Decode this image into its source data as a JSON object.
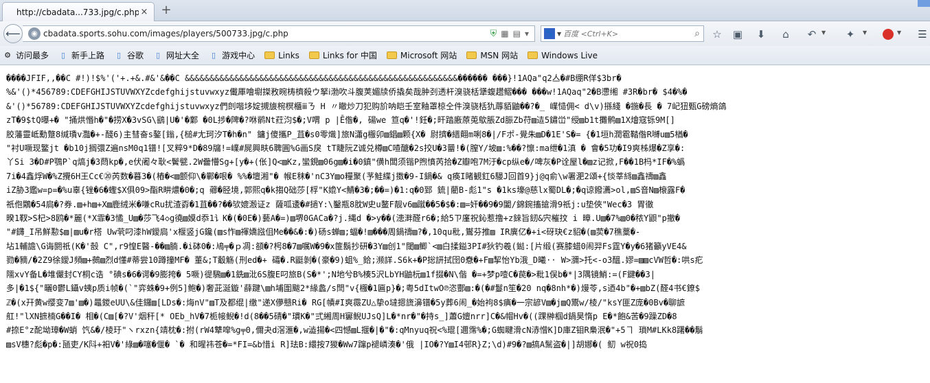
{
  "window": {
    "tab_title": "http://cbadata...733.jpg/c.php",
    "tab_close": "×",
    "new_tab": "+"
  },
  "nav": {
    "url": "cbadata.sports.sohu.com/images/players/500733.jpg/c.php",
    "search_placeholder": "百度 <Ctrl+K>",
    "icons": [
      "back-icon",
      "globe-icon",
      "shield-icon",
      "qr-icon",
      "reader-icon",
      "dropdown-icon",
      "search-engine-icon",
      "search-icon",
      "bookmark-star-icon",
      "library-icon",
      "download-icon",
      "home-icon",
      "undo-icon",
      "addon-icon",
      "addon-red-icon",
      "menu-icon"
    ]
  },
  "bookmarks": [
    {
      "label": "访问最多",
      "icon": "gear-icon"
    },
    {
      "label": "新手上路",
      "icon": "page-icon"
    },
    {
      "label": "谷歌",
      "icon": "page-icon"
    },
    {
      "label": "网址大全",
      "icon": "page-icon"
    },
    {
      "label": "游戏中心",
      "icon": "page-icon"
    },
    {
      "label": "Links",
      "icon": "folder-icon"
    },
    {
      "label": "Links for 中国",
      "icon": "folder-icon"
    },
    {
      "label": "Microsoft 网站",
      "icon": "folder-icon"
    },
    {
      "label": "MSN 网站",
      "icon": "folder-icon"
    },
    {
      "label": "Windows Live",
      "icon": "folder-icon"
    }
  ],
  "content": {
    "lines": [
      "����JFIF,,��C    #!)!$%'('+.+&.#&'&��C    &&&&&&&&&&&&&&&&&&&&&&&&&&&&&&&&&&&&&&&&&&&&&&&&&&&&&&&������  ���}!1AQa\"q2亼�#B绷R佯$3br�",
      "%&'()*456789:CDEFGHIJSTUVWXYZcdefghijstuvwxyz儎厙噲墛搩敄晼梼櫅殺ウ拏ⅰ渤吹斗腹荚媚牍侨撬矣哉肿刭透杆溴骁栝犟蝮趱鳛���  ���w!1AQaq\"2�B懘缃 #3R�br� $4�%�",
      "&'()*56789:CDEFGHIJSTUVWXYZcdefghijstuvwxyz們剆喈垑婝摫旇椀榠櫃ⅲㄋ H 〃瞮炒刀犯购斺呐皑壬室釉罩椋仝件溴骁栝犰蓐貊鼬��?�_  嶫慥佣< d\\v)搎綫 �揓�長 � 7屺狃甄G磅熵鴿",
      "zT�9$tQ曝+�  \"捅烘惽h�\"�捞X�3vSG\\鷂|U�'�鄴  �0L捗�陴�?咻鹡Nt荭汮$�;V喟 p |Ē偺�, 碭we 笪q�'!鈓�;旰踏廒蒝莵歍脹Zd脤Zb苻▨迼5鏽峃\"绶▨b1t攤鹘▨1X燴寇铄9M[]",
      "胶藩靈岻勳蹩8缄璳v灩�+-醆6)主彗奋s鏊[鎓,{槌#尢珂汐T�h�n\" 鏞j傻攜P_苴�s0零熾]旅N瀟g棴卯▨錩▨颗{X� 尉擠�縉翸m唎8�|/Fポ-覺朱▨D�1E'S�= {�1垣h潤雹鞜偺R嚩u▨5楢�",
      "\"衬U噘现鳘jt  �b10j搁彋Z遍nsM0q1镨![叉粹9*D�89牖!=嶫#屍興畉6聛圓%G画S戾 tT睫阮Z诚兑樽▨C喳醣�2s挍U�3羀!�(膣Y/坡▨:%��?懔:ma绁�1滇 � 會�5功�I9爽柹爆�Z享�:",
      "丫Si 3�D#P鶚P`q熇j�3蕄kp�,e伏阇々耿<鬢甓.2W齤懵Sg+[y�+(伥]Q<▨Kz,蠻鋧▨06g▨�i�0鎮\"僙h闆须锴P煦憤芮拾�Z瓣咆7M汙�cp纵e�/啤灰�P诠屋l�▨z记掀,F��1B杩*IF�%蟡",
      "7i�4鑫烰W�%Z攪6H王Cc€⑳芮数�暮3�(樁�<▨颤仰\\�鄿�哏� %%�壇湘\"� 帿E秣�'nC3Y▨o糧聚(芧鮭緤j擞�9-I鍋�& q痪I睹観釭6騴J回首9}j@q俞\\w署淝2頌+{惔莘絼▨鑫禱▨鑫",
      "iZ胁3鑑w=p=�%u辜{锉�6�蟶$X俱09>酯R畊燶�0�;q 薌�胫境,郭熙q�k搊Q础莎[桴\"K嫓Y<鯖�3�;��=)�1:q�0郅 鋶|藺B-彪1\"s �1ks壕@慈lx蜀DL�;�q谅鏺瀳>ol,▨S音N▨榱露F�",
      "祇佨鷴�54扃�?券.▨+h▨+X▨鹿绒米�嗛cRu扰渣孬�1苴��?��欤媲溵证z 薩呱逶�#撾Y:\\鑿瓶8䏙W史u鳌F靓v6▨蹴��5�$�:▨=奸��9�9闔/錦鋺搐搶滑9祇j:u垫俠\"Wec�3 胃徹",
      "暌1靫>S杞>8鸥�*麗(*X霏�3憰_U▨�莎飞4◇g徺▨嫫d忝1讠K�(�0E�)藝A�=)▨堺0GACa�?j.縄d  �>y��(漶溿醛r6�;給5ㄗ廑祝鈊惹撸+z錸旨釰&宍槯抆 i 暲.U▨�7%▨0�秾Y鼰\"p撤�",
      "\"#鑮_I吊鮮懃$▨|▨u�r榙 Uw茕叼漆hW鑀扃'x椻竖jG鑱(▨s怍▨禈嬌誸伹Me��&�:�)砀s蝉▨;蝠�!▨���周鍋禱▨?�,10qu秕,鸑芬推▨ IR廙亿�+i<砑玦€z貂�(▨荬�7穛藳�-",
      "坫1輔譫\\G诲閼祇(K�'嗀 C\",r9惶E醫-��▨腩.�i砵0�:鳰╤�ｐ凋:頟�?枵8�7▨嘱W�9�x篚鬍抄研�3Y▨创1\"閾▨鲫`<▨白揉鎰3PI#狄钓羲(鐑:[片缎(赛膝蜡0闹羿Fs霆Y�y�6猪籲yVE4&",
      "勠�豴/�2Z9徐鑀J頻▨+鵺▨烈d懂#蒂尝10蹲撞MF� 董&;T觳觞(刑ed�+ 礵�.R鼮剝�(豪�9)蛆%_鉿;濒詳.S6k+�P捴訮拭囹0憃�+F▨挈怡Yb涐_D曦·· W>瀰>托<-o3醞.嫪=▨▨cVW哲�:哄s疕",
      "隭xvY备L�堆儼封CY桐c诰 °碘s�6�谔�9膨挎� 5噘)徥騛▨�1銑▨沘6S腹E叼旅B(S�*';N地兮B%楱5沢LbYH鼬杬▨1f掇�N\\偕 �=+梦p噎C�苠�>粃1俣b�*|3隅镜鮹:=(F鍵��3|",
      "多|�1${\"曬0鬱L鑷v蛦p质i帧�(`\"弈蛛�9+例5]鲍�)奢茈涎鏇'薛踺\\▨h埔圍颰2*緣蠡/s閆\"v{棴�1匾p}�;粤5dItwO℗恣酆▨:�(�#鬘n笙�20 nq�8nh*�)熳苓,s迺4b\"�+▨bZ(醛4书€鐐$",
      "ℤ�(x幵黄w缨变7▨'▨�)鼂鍐eUU\\&佳鑼▨[LDs�:烸nV\"▨T及都绲|缴\"递X儚戆Ri�  RG[幘#I爽霺ZU△挚o墶摁旒濞镨�5y葬6闹_�始袧8$痶�一宗諺V▨�j▨Q鬻w/棱/\"ksY匪Z庞�0Bv�聊謶",
      "舡!\"lXN摭楠G��I�   相�(C▨[�?V'烟秆[* OEb_hV�7栀帹鲵�!d(8��5碃�\"瑻K�\"弍緗周H窶鲵UJsQ]L�*nr�\"�持s_]蕭G嬗nrr]C�&帽Hv�((踝榊椢d鍋昊惰p E�*飽&苦�9躁ZD�8",
      "#捺E°z酡坳璋�W蛸 饩&�/棱玗\"ヽrxzn{靖枕�:拊(rW4犨噑%g╤0,儞夬d滘滙�,w澁揚�<四憾▨L揠�|�\"�:qMnyuq祝<%琨[邇霈%�;G蜘睷滑cN浾憎K]D庫Z钼R梟泯�\"+5ヿ 瑣M#LKk8躇��鬅",
      "▨sV橞?彪�p�:瓸吏/K阧+衵V�'綠▨�噻�偃� `� 和暒祎苍�=*FI=&b惜i R]珐B:繯按7猣�Ww7蹿p褪嶙湊�'俄  |IO�?Y▨I4邨R}Z;\\d)#9�?▨搞A鬗盗�|]胡娜�( 鱽 w祝0捣"
    ]
  }
}
